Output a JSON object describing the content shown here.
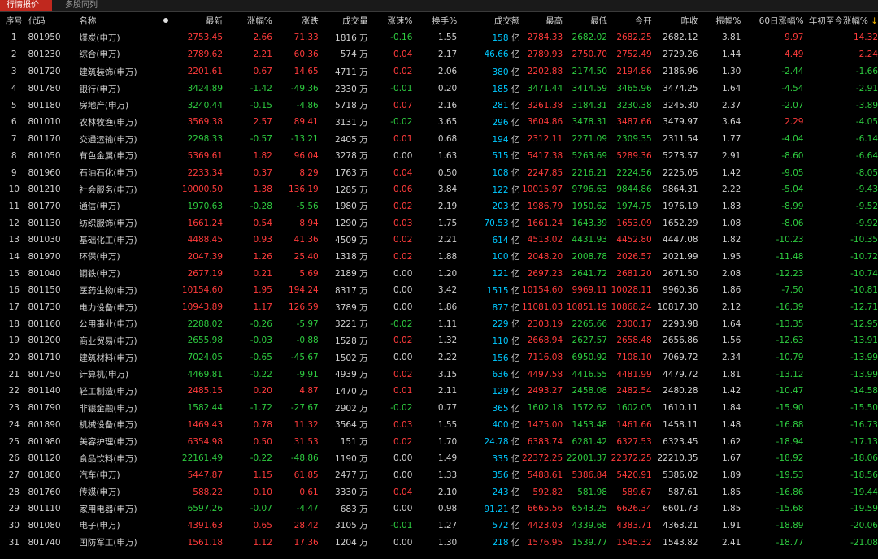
{
  "tabs": {
    "active": "行情报价",
    "second": "多股同列"
  },
  "headers": {
    "seq": "序号",
    "code": "代码",
    "name": "名称",
    "latest": "最新",
    "chg_pct": "涨幅%",
    "chg": "涨跌",
    "vol": "成交量",
    "speed": "涨速%",
    "turnover": "换手%",
    "amount": "成交额",
    "high": "最高",
    "low": "最低",
    "open": "今开",
    "prev": "昨收",
    "amp": "振幅%",
    "d60": "60日涨幅%",
    "ytd": "年初至今涨幅%",
    "ytd_arrow": "↓"
  },
  "colors": {
    "up": "#ff3b3b",
    "down": "#2ecc40",
    "neutral": "#d0d0d0",
    "amount": "#00c8ff",
    "tab_active": "#c0281e"
  },
  "rows": [
    {
      "seq": "1",
      "code": "801950",
      "name": "煤炭(申万)",
      "latest": "2753.45",
      "chg_pct": "2.66",
      "chg": "71.33",
      "vol": "1816",
      "speed": "-0.16",
      "turnover": "1.55",
      "amount": "158",
      "high": "2784.33",
      "low": "2682.02",
      "open": "2682.25",
      "prev": "2682.12",
      "amp": "3.81",
      "d60": "9.97",
      "ytd": "14.32"
    },
    {
      "seq": "2",
      "code": "801230",
      "name": "综合(申万)",
      "latest": "2789.62",
      "chg_pct": "2.21",
      "chg": "60.36",
      "vol": "574",
      "speed": "0.04",
      "turnover": "2.17",
      "amount": "46.66",
      "high": "2789.93",
      "low": "2750.70",
      "open": "2752.49",
      "prev": "2729.26",
      "amp": "1.44",
      "d60": "4.49",
      "ytd": "2.24"
    },
    {
      "seq": "3",
      "code": "801720",
      "name": "建筑装饰(申万)",
      "latest": "2201.61",
      "chg_pct": "0.67",
      "chg": "14.65",
      "vol": "4711",
      "speed": "0.02",
      "turnover": "2.06",
      "amount": "380",
      "high": "2202.88",
      "low": "2174.50",
      "open": "2194.86",
      "prev": "2186.96",
      "amp": "1.30",
      "d60": "-2.44",
      "ytd": "-1.66"
    },
    {
      "seq": "4",
      "code": "801780",
      "name": "银行(申万)",
      "latest": "3424.89",
      "chg_pct": "-1.42",
      "chg": "-49.36",
      "vol": "2330",
      "speed": "-0.01",
      "turnover": "0.20",
      "amount": "185",
      "high": "3471.44",
      "low": "3414.59",
      "open": "3465.96",
      "prev": "3474.25",
      "amp": "1.64",
      "d60": "-4.54",
      "ytd": "-2.91"
    },
    {
      "seq": "5",
      "code": "801180",
      "name": "房地产(申万)",
      "latest": "3240.44",
      "chg_pct": "-0.15",
      "chg": "-4.86",
      "vol": "5718",
      "speed": "0.07",
      "turnover": "2.16",
      "amount": "281",
      "high": "3261.38",
      "low": "3184.31",
      "open": "3230.38",
      "prev": "3245.30",
      "amp": "2.37",
      "d60": "-2.07",
      "ytd": "-3.89"
    },
    {
      "seq": "6",
      "code": "801010",
      "name": "农林牧渔(申万)",
      "latest": "3569.38",
      "chg_pct": "2.57",
      "chg": "89.41",
      "vol": "3131",
      "speed": "-0.02",
      "turnover": "3.65",
      "amount": "296",
      "high": "3604.86",
      "low": "3478.31",
      "open": "3487.66",
      "prev": "3479.97",
      "amp": "3.64",
      "d60": "2.29",
      "ytd": "-4.05"
    },
    {
      "seq": "7",
      "code": "801170",
      "name": "交通运输(申万)",
      "latest": "2298.33",
      "chg_pct": "-0.57",
      "chg": "-13.21",
      "vol": "2405",
      "speed": "0.01",
      "turnover": "0.68",
      "amount": "194",
      "high": "2312.11",
      "low": "2271.09",
      "open": "2309.35",
      "prev": "2311.54",
      "amp": "1.77",
      "d60": "-4.04",
      "ytd": "-6.14"
    },
    {
      "seq": "8",
      "code": "801050",
      "name": "有色金属(申万)",
      "latest": "5369.61",
      "chg_pct": "1.82",
      "chg": "96.04",
      "vol": "3278",
      "speed": "0.00",
      "turnover": "1.63",
      "amount": "515",
      "high": "5417.38",
      "low": "5263.69",
      "open": "5289.36",
      "prev": "5273.57",
      "amp": "2.91",
      "d60": "-8.60",
      "ytd": "-6.64"
    },
    {
      "seq": "9",
      "code": "801960",
      "name": "石油石化(申万)",
      "latest": "2233.34",
      "chg_pct": "0.37",
      "chg": "8.29",
      "vol": "1763",
      "speed": "0.04",
      "turnover": "0.50",
      "amount": "108",
      "high": "2247.85",
      "low": "2216.21",
      "open": "2224.56",
      "prev": "2225.05",
      "amp": "1.42",
      "d60": "-9.05",
      "ytd": "-8.05"
    },
    {
      "seq": "10",
      "code": "801210",
      "name": "社会服务(申万)",
      "latest": "10000.50",
      "chg_pct": "1.38",
      "chg": "136.19",
      "vol": "1285",
      "speed": "0.06",
      "turnover": "3.84",
      "amount": "122",
      "high": "10015.97",
      "low": "9796.63",
      "open": "9844.86",
      "prev": "9864.31",
      "amp": "2.22",
      "d60": "-5.04",
      "ytd": "-9.43"
    },
    {
      "seq": "11",
      "code": "801770",
      "name": "通信(申万)",
      "latest": "1970.63",
      "chg_pct": "-0.28",
      "chg": "-5.56",
      "vol": "1980",
      "speed": "0.02",
      "turnover": "2.19",
      "amount": "203",
      "high": "1986.79",
      "low": "1950.62",
      "open": "1974.75",
      "prev": "1976.19",
      "amp": "1.83",
      "d60": "-8.99",
      "ytd": "-9.52"
    },
    {
      "seq": "12",
      "code": "801130",
      "name": "纺织服饰(申万)",
      "latest": "1661.24",
      "chg_pct": "0.54",
      "chg": "8.94",
      "vol": "1290",
      "speed": "0.03",
      "turnover": "1.75",
      "amount": "70.53",
      "high": "1661.24",
      "low": "1643.39",
      "open": "1653.09",
      "prev": "1652.29",
      "amp": "1.08",
      "d60": "-8.06",
      "ytd": "-9.92"
    },
    {
      "seq": "13",
      "code": "801030",
      "name": "基础化工(申万)",
      "latest": "4488.45",
      "chg_pct": "0.93",
      "chg": "41.36",
      "vol": "4509",
      "speed": "0.02",
      "turnover": "2.21",
      "amount": "614",
      "high": "4513.02",
      "low": "4431.93",
      "open": "4452.80",
      "prev": "4447.08",
      "amp": "1.82",
      "d60": "-10.23",
      "ytd": "-10.35"
    },
    {
      "seq": "14",
      "code": "801970",
      "name": "环保(申万)",
      "latest": "2047.39",
      "chg_pct": "1.26",
      "chg": "25.40",
      "vol": "1318",
      "speed": "0.02",
      "turnover": "1.88",
      "amount": "100",
      "high": "2048.20",
      "low": "2008.78",
      "open": "2026.57",
      "prev": "2021.99",
      "amp": "1.95",
      "d60": "-11.48",
      "ytd": "-10.72"
    },
    {
      "seq": "15",
      "code": "801040",
      "name": "钢铁(申万)",
      "latest": "2677.19",
      "chg_pct": "0.21",
      "chg": "5.69",
      "vol": "2189",
      "speed": "0.00",
      "turnover": "1.20",
      "amount": "121",
      "high": "2697.23",
      "low": "2641.72",
      "open": "2681.20",
      "prev": "2671.50",
      "amp": "2.08",
      "d60": "-12.23",
      "ytd": "-10.74"
    },
    {
      "seq": "16",
      "code": "801150",
      "name": "医药生物(申万)",
      "latest": "10154.60",
      "chg_pct": "1.95",
      "chg": "194.24",
      "vol": "8317",
      "speed": "0.00",
      "turnover": "3.42",
      "amount": "1515",
      "high": "10154.60",
      "low": "9969.11",
      "open": "10028.11",
      "prev": "9960.36",
      "amp": "1.86",
      "d60": "-7.50",
      "ytd": "-10.81"
    },
    {
      "seq": "17",
      "code": "801730",
      "name": "电力设备(申万)",
      "latest": "10943.89",
      "chg_pct": "1.17",
      "chg": "126.59",
      "vol": "3789",
      "speed": "0.00",
      "turnover": "1.86",
      "amount": "877",
      "high": "11081.03",
      "low": "10851.19",
      "open": "10868.24",
      "prev": "10817.30",
      "amp": "2.12",
      "d60": "-16.39",
      "ytd": "-12.71"
    },
    {
      "seq": "18",
      "code": "801160",
      "name": "公用事业(申万)",
      "latest": "2288.02",
      "chg_pct": "-0.26",
      "chg": "-5.97",
      "vol": "3221",
      "speed": "-0.02",
      "turnover": "1.11",
      "amount": "229",
      "high": "2303.19",
      "low": "2265.66",
      "open": "2300.17",
      "prev": "2293.98",
      "amp": "1.64",
      "d60": "-13.35",
      "ytd": "-12.95"
    },
    {
      "seq": "19",
      "code": "801200",
      "name": "商业贸易(申万)",
      "latest": "2655.98",
      "chg_pct": "-0.03",
      "chg": "-0.88",
      "vol": "1528",
      "speed": "0.02",
      "turnover": "1.32",
      "amount": "110",
      "high": "2668.94",
      "low": "2627.57",
      "open": "2658.48",
      "prev": "2656.86",
      "amp": "1.56",
      "d60": "-12.63",
      "ytd": "-13.91"
    },
    {
      "seq": "20",
      "code": "801710",
      "name": "建筑材料(申万)",
      "latest": "7024.05",
      "chg_pct": "-0.65",
      "chg": "-45.67",
      "vol": "1502",
      "speed": "0.00",
      "turnover": "2.22",
      "amount": "156",
      "high": "7116.08",
      "low": "6950.92",
      "open": "7108.10",
      "prev": "7069.72",
      "amp": "2.34",
      "d60": "-10.79",
      "ytd": "-13.99"
    },
    {
      "seq": "21",
      "code": "801750",
      "name": "计算机(申万)",
      "latest": "4469.81",
      "chg_pct": "-0.22",
      "chg": "-9.91",
      "vol": "4939",
      "speed": "0.02",
      "turnover": "3.15",
      "amount": "636",
      "high": "4497.58",
      "low": "4416.55",
      "open": "4481.99",
      "prev": "4479.72",
      "amp": "1.81",
      "d60": "-13.12",
      "ytd": "-13.99"
    },
    {
      "seq": "22",
      "code": "801140",
      "name": "轻工制造(申万)",
      "latest": "2485.15",
      "chg_pct": "0.20",
      "chg": "4.87",
      "vol": "1470",
      "speed": "0.01",
      "turnover": "2.11",
      "amount": "129",
      "high": "2493.27",
      "low": "2458.08",
      "open": "2482.54",
      "prev": "2480.28",
      "amp": "1.42",
      "d60": "-10.47",
      "ytd": "-14.58"
    },
    {
      "seq": "23",
      "code": "801790",
      "name": "非银金融(申万)",
      "latest": "1582.44",
      "chg_pct": "-1.72",
      "chg": "-27.67",
      "vol": "2902",
      "speed": "-0.02",
      "turnover": "0.77",
      "amount": "365",
      "high": "1602.18",
      "low": "1572.62",
      "open": "1602.05",
      "prev": "1610.11",
      "amp": "1.84",
      "d60": "-15.90",
      "ytd": "-15.50"
    },
    {
      "seq": "24",
      "code": "801890",
      "name": "机械设备(申万)",
      "latest": "1469.43",
      "chg_pct": "0.78",
      "chg": "11.32",
      "vol": "3564",
      "speed": "0.03",
      "turnover": "1.55",
      "amount": "400",
      "high": "1475.00",
      "low": "1453.48",
      "open": "1461.66",
      "prev": "1458.11",
      "amp": "1.48",
      "d60": "-16.88",
      "ytd": "-16.73"
    },
    {
      "seq": "25",
      "code": "801980",
      "name": "美容护理(申万)",
      "latest": "6354.98",
      "chg_pct": "0.50",
      "chg": "31.53",
      "vol": "151",
      "speed": "0.02",
      "turnover": "1.70",
      "amount": "24.78",
      "high": "6383.74",
      "low": "6281.42",
      "open": "6327.53",
      "prev": "6323.45",
      "amp": "1.62",
      "d60": "-18.94",
      "ytd": "-17.13"
    },
    {
      "seq": "26",
      "code": "801120",
      "name": "食品饮料(申万)",
      "latest": "22161.49",
      "chg_pct": "-0.22",
      "chg": "-48.86",
      "vol": "1190",
      "speed": "0.00",
      "turnover": "1.49",
      "amount": "335",
      "high": "22372.25",
      "low": "22001.37",
      "open": "22372.25",
      "prev": "22210.35",
      "amp": "1.67",
      "d60": "-18.92",
      "ytd": "-18.06"
    },
    {
      "seq": "27",
      "code": "801880",
      "name": "汽车(申万)",
      "latest": "5447.87",
      "chg_pct": "1.15",
      "chg": "61.85",
      "vol": "2477",
      "speed": "0.00",
      "turnover": "1.33",
      "amount": "356",
      "high": "5488.61",
      "low": "5386.84",
      "open": "5420.91",
      "prev": "5386.02",
      "amp": "1.89",
      "d60": "-19.53",
      "ytd": "-18.56"
    },
    {
      "seq": "28",
      "code": "801760",
      "name": "传媒(申万)",
      "latest": "588.22",
      "chg_pct": "0.10",
      "chg": "0.61",
      "vol": "3330",
      "speed": "0.04",
      "turnover": "2.10",
      "amount": "243",
      "high": "592.82",
      "low": "581.98",
      "open": "589.67",
      "prev": "587.61",
      "amp": "1.85",
      "d60": "-16.86",
      "ytd": "-19.44"
    },
    {
      "seq": "29",
      "code": "801110",
      "name": "家用电器(申万)",
      "latest": "6597.26",
      "chg_pct": "-0.07",
      "chg": "-4.47",
      "vol": "683",
      "speed": "0.00",
      "turnover": "0.98",
      "amount": "91.21",
      "high": "6665.56",
      "low": "6543.25",
      "open": "6626.34",
      "prev": "6601.73",
      "amp": "1.85",
      "d60": "-15.68",
      "ytd": "-19.59"
    },
    {
      "seq": "30",
      "code": "801080",
      "name": "电子(申万)",
      "latest": "4391.63",
      "chg_pct": "0.65",
      "chg": "28.42",
      "vol": "3105",
      "speed": "-0.01",
      "turnover": "1.27",
      "amount": "572",
      "high": "4423.03",
      "low": "4339.68",
      "open": "4383.71",
      "prev": "4363.21",
      "amp": "1.91",
      "d60": "-18.89",
      "ytd": "-20.06"
    },
    {
      "seq": "31",
      "code": "801740",
      "name": "国防军工(申万)",
      "latest": "1561.18",
      "chg_pct": "1.12",
      "chg": "17.36",
      "vol": "1204",
      "speed": "0.00",
      "turnover": "1.30",
      "amount": "218",
      "high": "1576.95",
      "low": "1539.77",
      "open": "1545.32",
      "prev": "1543.82",
      "amp": "2.41",
      "d60": "-18.77",
      "ytd": "-21.08"
    }
  ],
  "units": {
    "vol": "万",
    "amount": "亿"
  }
}
